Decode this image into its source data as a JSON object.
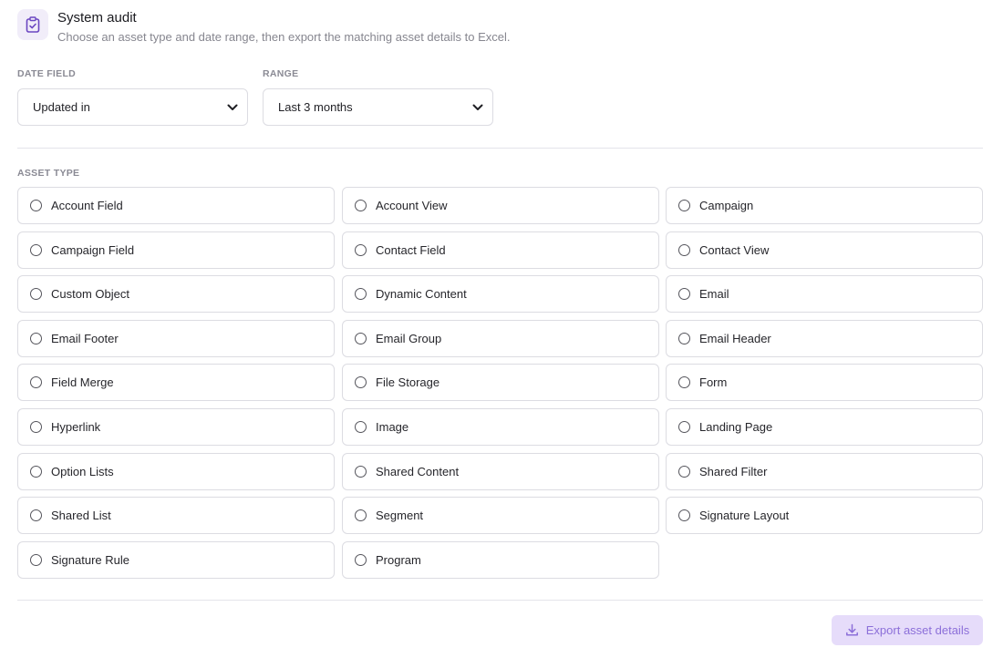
{
  "header": {
    "title": "System audit",
    "subtitle": "Choose an asset type and date range, then export the matching asset details to Excel.",
    "icon": "clipboard-check-icon",
    "accent_color": "#6b46c1"
  },
  "filters": {
    "date_field": {
      "label": "DATE FIELD",
      "value": "Updated in"
    },
    "range": {
      "label": "RANGE",
      "value": "Last 3 months"
    }
  },
  "asset_type": {
    "label": "ASSET TYPE",
    "options": [
      "Account Field",
      "Account View",
      "Campaign",
      "Campaign Field",
      "Contact Field",
      "Contact View",
      "Custom Object",
      "Dynamic Content",
      "Email",
      "Email Footer",
      "Email Group",
      "Email Header",
      "Field Merge",
      "File Storage",
      "Form",
      "Hyperlink",
      "Image",
      "Landing Page",
      "Option Lists",
      "Shared Content",
      "Shared Filter",
      "Shared List",
      "Segment",
      "Signature Layout",
      "Signature Rule",
      "Program"
    ]
  },
  "actions": {
    "export_label": "Export asset details",
    "export_bg": "#e6dcfa",
    "export_color": "#8c6fd9"
  }
}
